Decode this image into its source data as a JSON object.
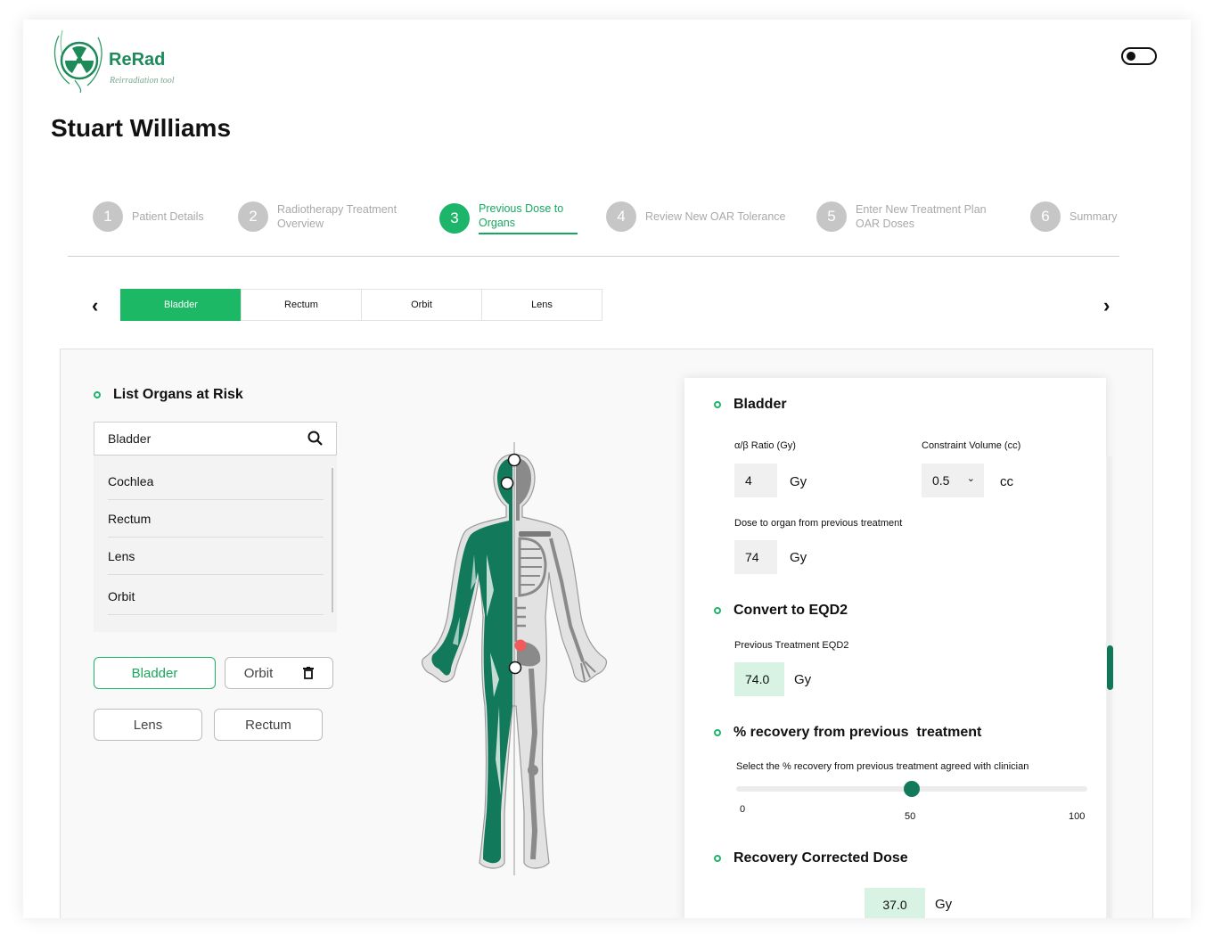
{
  "app": {
    "logo_name": "ReRad",
    "logo_sub": "Reirradiation tool",
    "brand_color": "#1db56a",
    "dark_accent": "#127a5a"
  },
  "patient": {
    "name": "Stuart Williams"
  },
  "stepper": [
    {
      "num": "1",
      "label": "Patient Details",
      "active": false
    },
    {
      "num": "2",
      "label": "Radiotherapy Treatment Overview",
      "active": false
    },
    {
      "num": "3",
      "label": "Previous Dose to Organs",
      "active": true
    },
    {
      "num": "4",
      "label": "Review New OAR Tolerance",
      "active": false
    },
    {
      "num": "5",
      "label": "Enter New Treatment Plan OAR Doses",
      "active": false
    },
    {
      "num": "6",
      "label": "Summary",
      "active": false
    }
  ],
  "tabs": {
    "prev_icon": "chevron-left-icon",
    "next_icon": "chevron-right-icon",
    "items": [
      "Bladder",
      "Rectum",
      "Orbit",
      "Lens"
    ],
    "active": "Bladder"
  },
  "organs": {
    "title": "List Organs at Risk",
    "search_value": "Bladder",
    "search_icon": "search-icon",
    "list": [
      "Cochlea",
      "Rectum",
      "Lens",
      "Orbit"
    ],
    "chips": [
      "Bladder",
      "Orbit",
      "Lens",
      "Rectum"
    ]
  },
  "detail": {
    "organ_title": "Bladder",
    "alpha_beta_label": "α/β Ratio (Gy)",
    "alpha_beta_value": "4",
    "alpha_beta_unit": "Gy",
    "constraint_label": "Constraint Volume (cc)",
    "constraint_value": "0.5",
    "constraint_unit": "cc",
    "prev_dose_label": "Dose to organ from previous treatment",
    "prev_dose_value": "74",
    "prev_dose_unit": "Gy",
    "eqd2_title": "Convert to EQD2",
    "eqd2_label": "Previous Treatment EQD2",
    "eqd2_value": "74.0",
    "eqd2_unit": "Gy",
    "recovery_title": "% recovery from previous  treatment",
    "recovery_label": "Select the % recovery from previous treatment agreed with clinician",
    "recovery_value": 50,
    "recovery_min": "0",
    "recovery_mid": "50",
    "recovery_max": "100",
    "corrected_title": "Recovery Corrected Dose",
    "corrected_value": "37.0",
    "corrected_unit": "Gy"
  }
}
